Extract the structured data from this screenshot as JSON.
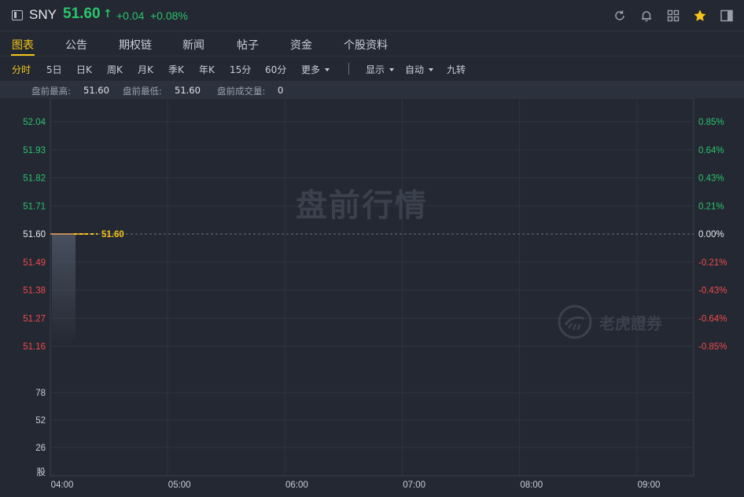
{
  "header": {
    "symbol": "SNY",
    "price": "51.60",
    "arrow": "↑",
    "change": "+0.04",
    "change_pct": "+0.08%",
    "icons": [
      "refresh-icon",
      "bell-icon",
      "grid-icon",
      "star-icon",
      "sidebar-icon"
    ],
    "colors": {
      "up": "#2bc46b",
      "down": "#ef4b4b",
      "accent": "#f5c518"
    }
  },
  "tabs": [
    {
      "label": "图表",
      "active": true
    },
    {
      "label": "公告",
      "active": false
    },
    {
      "label": "期权链",
      "active": false
    },
    {
      "label": "新闻",
      "active": false
    },
    {
      "label": "帖子",
      "active": false
    },
    {
      "label": "资金",
      "active": false
    },
    {
      "label": "个股资料",
      "active": false
    }
  ],
  "toolbar": {
    "periods": [
      {
        "label": "分时",
        "active": true
      },
      {
        "label": "5日",
        "active": false
      },
      {
        "label": "日K",
        "active": false
      },
      {
        "label": "周K",
        "active": false
      },
      {
        "label": "月K",
        "active": false
      },
      {
        "label": "季K",
        "active": false
      },
      {
        "label": "年K",
        "active": false
      },
      {
        "label": "15分",
        "active": false
      },
      {
        "label": "60分",
        "active": false
      }
    ],
    "more_label": "更多",
    "display_label": "显示",
    "auto_label": "自动",
    "nine_label": "九转"
  },
  "infobar": {
    "high_label": "盘前最高:",
    "high_value": "51.60",
    "low_label": "盘前最低:",
    "low_value": "51.60",
    "volume_label": "盘前成交量:",
    "volume_value": "0"
  },
  "watermark": "盘前行情",
  "logo_text": "老虎證券",
  "chart_data": {
    "type": "line",
    "price_axis_left": [
      "52.04",
      "51.93",
      "51.82",
      "51.71",
      "51.60",
      "51.49",
      "51.38",
      "51.27",
      "51.16"
    ],
    "price_axis_right": [
      "0.85%",
      "0.64%",
      "0.43%",
      "0.21%",
      "0.00%",
      "-0.21%",
      "-0.43%",
      "-0.64%",
      "-0.85%"
    ],
    "volume_axis": [
      "78",
      "52",
      "26",
      "股"
    ],
    "x_ticks": [
      "04:00",
      "05:00",
      "06:00",
      "07:00",
      "08:00",
      "09:00"
    ],
    "ylim": [
      51.16,
      52.04
    ],
    "prev_close": 51.6,
    "series": [
      {
        "x": [
          "04:00",
          "04:11"
        ],
        "values": [
          51.6,
          51.6
        ]
      }
    ],
    "last_price_label": "51.60",
    "grid": true
  }
}
